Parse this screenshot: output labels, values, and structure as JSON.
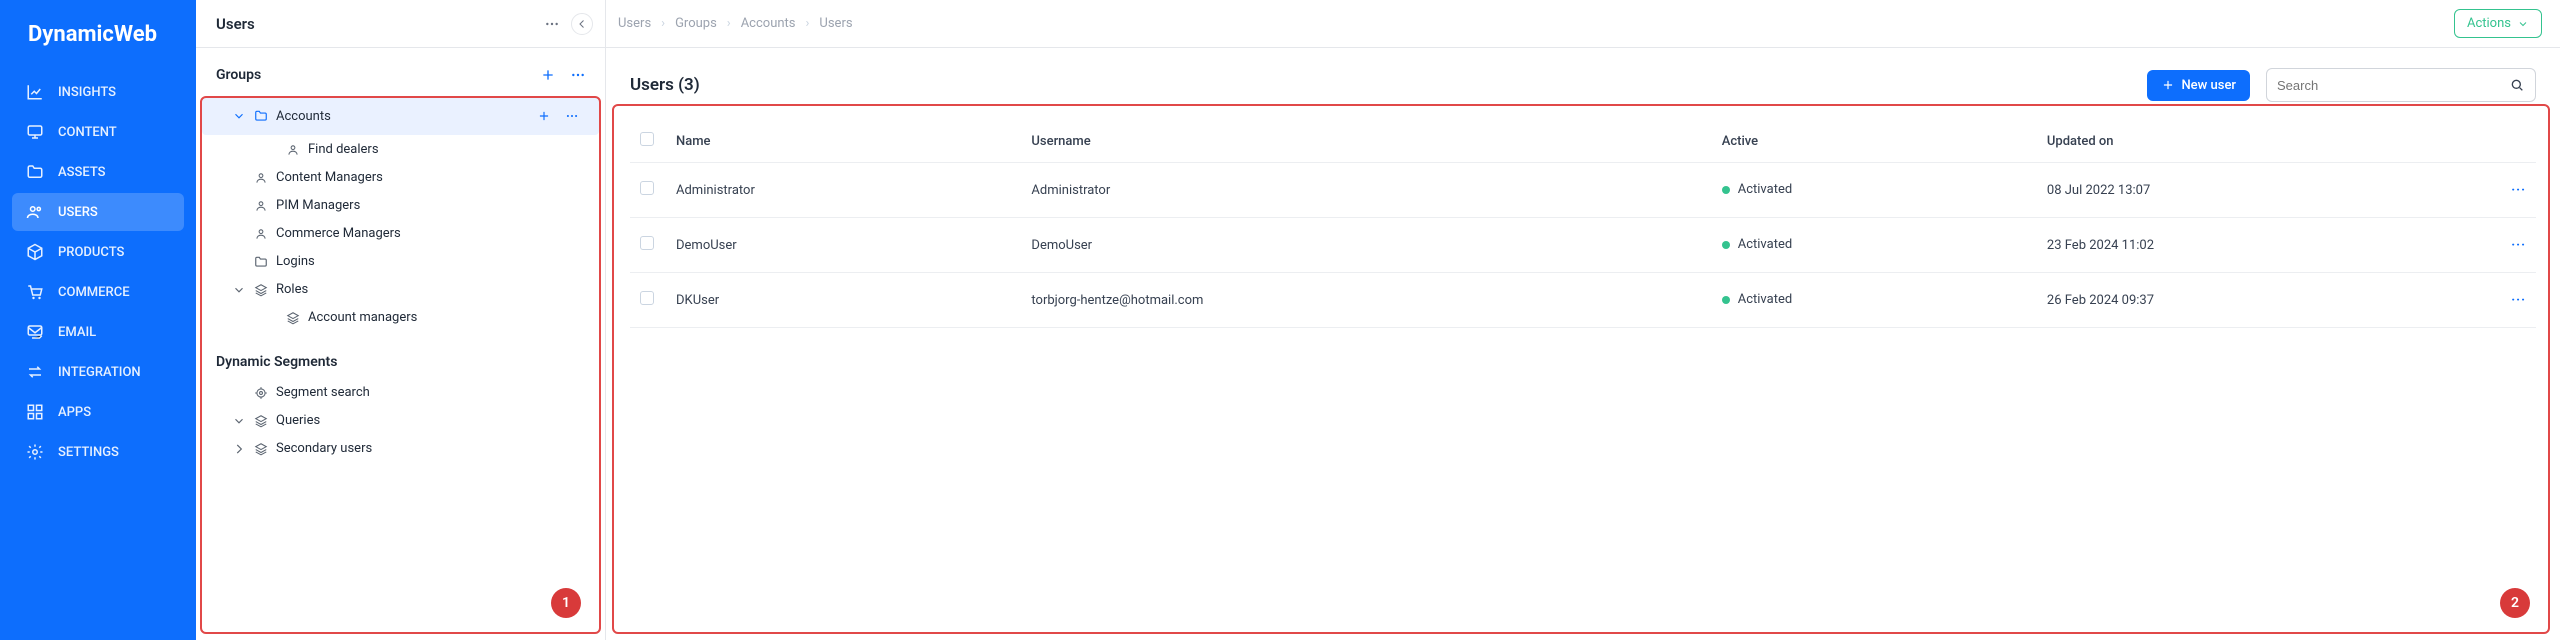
{
  "brand": "DynamicWeb",
  "nav": {
    "items": [
      {
        "key": "insights",
        "label": "INSIGHTS"
      },
      {
        "key": "content",
        "label": "CONTENT"
      },
      {
        "key": "assets",
        "label": "ASSETS"
      },
      {
        "key": "users",
        "label": "USERS",
        "active": true
      },
      {
        "key": "products",
        "label": "PRODUCTS"
      },
      {
        "key": "commerce",
        "label": "COMMERCE"
      },
      {
        "key": "email",
        "label": "EMAIL"
      },
      {
        "key": "integration",
        "label": "INTEGRATION"
      },
      {
        "key": "apps",
        "label": "APPS"
      },
      {
        "key": "settings",
        "label": "SETTINGS"
      }
    ]
  },
  "panel": {
    "title": "Users",
    "groups_section": "Groups",
    "segments_section": "Dynamic Segments",
    "tree_groups": [
      {
        "label": "Accounts",
        "icon": "folder",
        "depth": 1,
        "selected": true,
        "expandable": true,
        "expanded": true
      },
      {
        "label": "Find dealers",
        "icon": "user",
        "depth": 2
      },
      {
        "label": "Content Managers",
        "icon": "user",
        "depth": 1
      },
      {
        "label": "PIM Managers",
        "icon": "user",
        "depth": 1
      },
      {
        "label": "Commerce Managers",
        "icon": "user",
        "depth": 1
      },
      {
        "label": "Logins",
        "icon": "folder",
        "depth": 1
      },
      {
        "label": "Roles",
        "icon": "layers",
        "depth": 1,
        "expandable": true,
        "expanded": true
      },
      {
        "label": "Account managers",
        "icon": "layers",
        "depth": 2
      }
    ],
    "tree_segments": [
      {
        "label": "Segment search",
        "icon": "search-target",
        "depth": 1
      },
      {
        "label": "Queries",
        "icon": "layers",
        "depth": 1,
        "expandable": true,
        "expanded": true
      },
      {
        "label": "Secondary users",
        "icon": "layers",
        "depth": 1,
        "expandable": true,
        "expanded": false
      }
    ],
    "callout1": "1"
  },
  "main": {
    "breadcrumbs": [
      "Users",
      "Groups",
      "Accounts",
      "Users"
    ],
    "actions_label": "Actions",
    "heading": "Users (3)",
    "new_user_label": "New user",
    "search_placeholder": "Search",
    "columns": {
      "name": "Name",
      "username": "Username",
      "active": "Active",
      "updated": "Updated on"
    },
    "status_label": "Activated",
    "rows": [
      {
        "name": "Administrator",
        "username": "Administrator",
        "updated": "08 Jul 2022 13:07"
      },
      {
        "name": "DemoUser",
        "username": "DemoUser",
        "updated": "23 Feb 2024 11:02"
      },
      {
        "name": "DKUser",
        "username": "torbjorg-hentze@hotmail.com",
        "updated": "26 Feb 2024 09:37"
      }
    ],
    "callout2": "2"
  }
}
